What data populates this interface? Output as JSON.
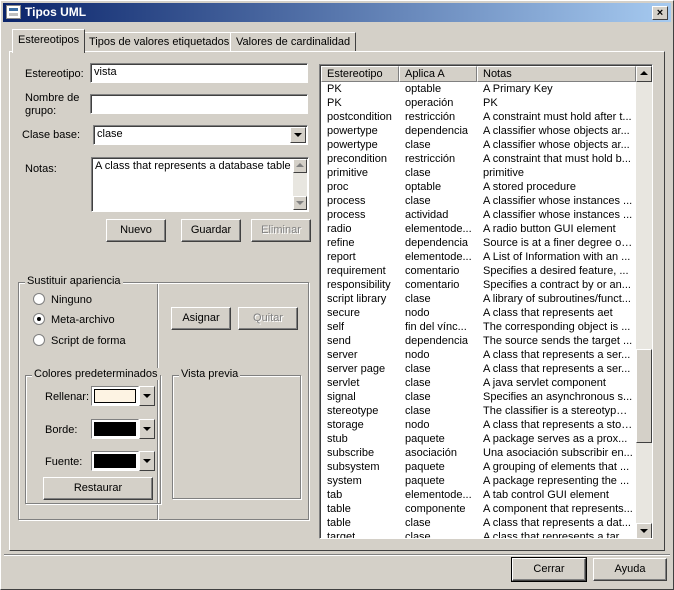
{
  "window": {
    "title": "Tipos UML",
    "close_glyph": "×",
    "icon": "uml-app-icon"
  },
  "tabs": [
    {
      "label": "Estereotipos",
      "active": true
    },
    {
      "label": "Tipos de valores etiquetados",
      "active": false
    },
    {
      "label": "Valores de cardinalidad",
      "active": false
    }
  ],
  "form": {
    "estereotipo_label": "Estereotipo:",
    "estereotipo_value": "vista",
    "nombre_grupo_label_line1": "Nombre de",
    "nombre_grupo_label_line2": "grupo:",
    "nombre_grupo_value": "",
    "clase_base_label": "Clase base:",
    "clase_base_value": "clase",
    "notas_label": "Notas:",
    "notas_value": "A class that represents a database table"
  },
  "buttons": {
    "nuevo": "Nuevo",
    "guardar": "Guardar",
    "eliminar": "Eliminar",
    "asignar": "Asignar",
    "quitar": "Quitar",
    "restaurar": "Restaurar",
    "cerrar": "Cerrar",
    "ayuda": "Ayuda"
  },
  "apariencia": {
    "title": "Sustituir apariencia",
    "options": [
      {
        "label": "Ninguno",
        "selected": false
      },
      {
        "label": "Meta-archivo",
        "selected": true
      },
      {
        "label": "Script de forma",
        "selected": false
      }
    ]
  },
  "colores": {
    "title": "Colores predeterminados",
    "rellenar_label": "Rellenar:",
    "rellenar_color": "#fdf3e3",
    "borde_label": "Borde:",
    "borde_color": "#000000",
    "fuente_label": "Fuente:",
    "fuente_color": "#000000"
  },
  "vista_previa": {
    "title": "Vista previa"
  },
  "list": {
    "headers": [
      "Estereotipo",
      "Aplica A",
      "Notas"
    ],
    "rows": [
      [
        "PK",
        "optable",
        "A Primary Key"
      ],
      [
        "PK",
        "operación",
        "PK"
      ],
      [
        "postcondition",
        "restricción",
        "A constraint must hold after t..."
      ],
      [
        "powertype",
        "dependencia",
        "A classifier whose objects ar..."
      ],
      [
        "powertype",
        "clase",
        "A classifier whose objects ar..."
      ],
      [
        "precondition",
        "restricción",
        "A constraint that must hold b..."
      ],
      [
        "primitive",
        "clase",
        "primitive"
      ],
      [
        "proc",
        "optable",
        "A stored procedure"
      ],
      [
        "process",
        "clase",
        "A classifier whose instances ..."
      ],
      [
        "process",
        "actividad",
        "A classifier whose instances ..."
      ],
      [
        "radio",
        "elementode...",
        "A radio button GUI element"
      ],
      [
        "refine",
        "dependencia",
        "Source is at a finer degree of..."
      ],
      [
        "report",
        "elementode...",
        "A List of Information with an ..."
      ],
      [
        "requirement",
        "comentario",
        "Specifies a desired feature, ..."
      ],
      [
        "responsibility",
        "comentario",
        "Specifies a contract by or an..."
      ],
      [
        "script library",
        "clase",
        "A library of subroutines/funct..."
      ],
      [
        "secure",
        "nodo",
        "A class that represents aet"
      ],
      [
        "self",
        "fin del vínc...",
        "The corresponding object is ..."
      ],
      [
        "send",
        "dependencia",
        "The source sends the target ..."
      ],
      [
        "server",
        "nodo",
        "A class that represents a ser..."
      ],
      [
        "server page",
        "clase",
        "A class that represents a ser..."
      ],
      [
        "servlet",
        "clase",
        "A java servlet component"
      ],
      [
        "signal",
        "clase",
        "Specifies an asynchronous s..."
      ],
      [
        "stereotype",
        "clase",
        "The classifier is a stereotype ..."
      ],
      [
        "storage",
        "nodo",
        "A class that represents a stor..."
      ],
      [
        "stub",
        "paquete",
        "A package serves as a prox..."
      ],
      [
        "subscribe",
        "asociación",
        "Una asociación subscribir en..."
      ],
      [
        "subsystem",
        "paquete",
        "A grouping of elements that ..."
      ],
      [
        "system",
        "paquete",
        "A package representing the ..."
      ],
      [
        "tab",
        "elementode...",
        "A tab control GUI element"
      ],
      [
        "table",
        "componente",
        "A component that represents..."
      ],
      [
        "table",
        "clase",
        "A class that represents a dat..."
      ],
      [
        "target",
        "clase",
        "A class that represents a tar..."
      ]
    ],
    "scroll_position": 0.77
  }
}
